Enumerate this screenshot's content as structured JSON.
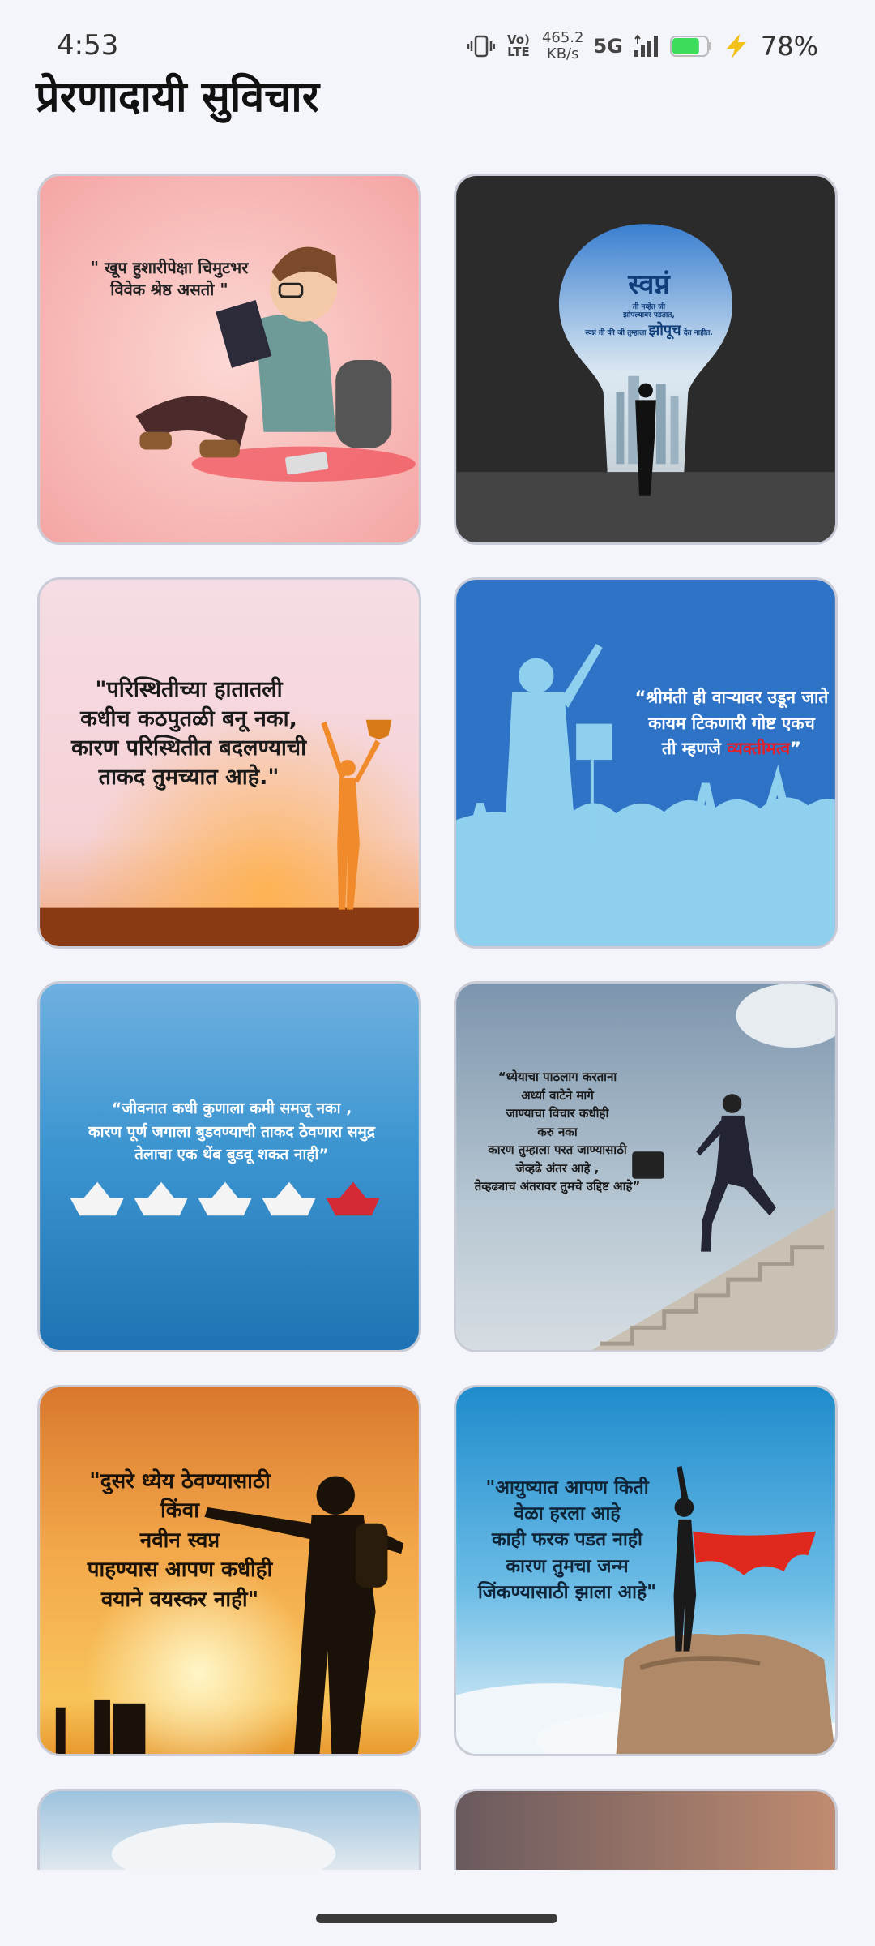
{
  "status_bar": {
    "time": "4:53",
    "volte": "Vo) LTE",
    "speed_value": "465.2",
    "speed_unit": "KB/s",
    "network": "5G",
    "battery_percent": "78%",
    "battery_level": 0.78,
    "battery_color": "#3ddc5a"
  },
  "header": {
    "title": "प्रेरणादायी सुविचार"
  },
  "cards": [
    {
      "quote_lines": [
        "\" खूप हुशारीपेक्षा चिमुटभर",
        "विवेक श्रेष्ठ असतो \""
      ],
      "bg": "#f6b3b0"
    },
    {
      "headline": "स्वप्नं",
      "small_1": "ती नव्हेत जी",
      "small_2": "झोपल्यावर पडतात,",
      "small_3": "स्वप्नं ती की जी तुम्हाला",
      "emph": "झोपूच",
      "small_4": "देत नाहीत.",
      "bg": "#2a2a2a"
    },
    {
      "quote_lines": [
        "\"परिस्थितीच्या हातातली",
        "कधीच कठपुतळी बनू नका,",
        "कारण परिस्थितीत बदलण्याची",
        "ताकद तुमच्यात आहे.\""
      ],
      "bg": "#f2d6de"
    },
    {
      "quote_line1": "“श्रीमंती ही वाऱ्यावर उडून जाते",
      "quote_line2": "कायम टिकणारी गोष्ट एकच",
      "quote_line3_pre": "ती म्हणजे ",
      "quote_line3_hl": "व्यक्तीमत्व",
      "quote_line3_post": "”",
      "bg": "#2f73c6"
    },
    {
      "quote_lines": [
        "“जीवनात कधी कुणाला कमी समजू नका ,",
        "कारण पूर्ण जगाला बुडवण्याची ताकद ठेवणारा समुद्र",
        "तेलाचा एक थेंब बुडवू शकत नाही”"
      ],
      "bg": "#2f86c4"
    },
    {
      "quote_lines": [
        "“ध्येयाचा पाठलाग करताना",
        "अर्ध्या वाटेने मागे",
        "जाण्याचा विचार कधीही",
        "करु नका",
        "कारण तुम्हाला परत जाण्यासाठी",
        "जेव्हढे अंतर आहे ,",
        "तेव्हढ्याच अंतरावर तुमचे उद्दिष्ट आहे”"
      ],
      "bg": "#8fa6ba"
    },
    {
      "quote_lines": [
        "\"दुसरे ध्येय ठेवण्यासाठी",
        "किंवा",
        "नवीन स्वप्न",
        "पाहण्यास आपण कधीही",
        "वयाने वयस्कर नाही\""
      ],
      "bg": "#f0a040"
    },
    {
      "quote_lines": [
        "\"आयुष्यात आपण किती",
        "वेळा हरला आहे",
        "काही फरक पडत नाही",
        "कारण तुमचा जन्म",
        "जिंकण्यासाठी झाला आहे\""
      ],
      "bg": "#2f9ad6"
    }
  ]
}
